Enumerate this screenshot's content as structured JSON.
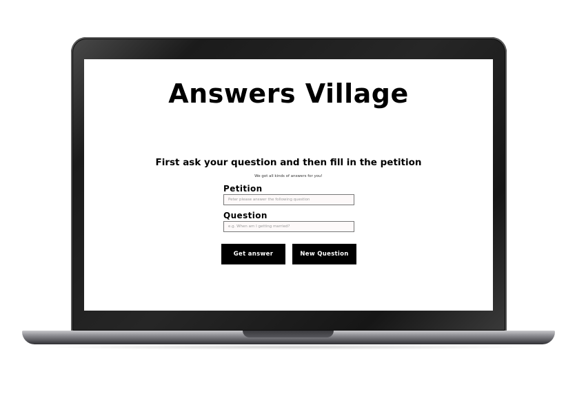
{
  "app": {
    "title": "Answers Village",
    "subtitle": "First ask your question and then fill in the petition",
    "tagline": "We got all kinds of answers for you!"
  },
  "form": {
    "petition": {
      "label": "Petition",
      "value": "",
      "placeholder": "Peter please answer the following question"
    },
    "question": {
      "label": "Question",
      "value": "",
      "placeholder": "e.g. When am I getting married?"
    }
  },
  "buttons": {
    "get_answer": "Get answer",
    "new_question": "New Question"
  },
  "colors": {
    "button_bg": "#000000",
    "button_text": "#ffffff",
    "input_bg": "#fdf9f9",
    "device_frame": "#1b1b1b"
  }
}
